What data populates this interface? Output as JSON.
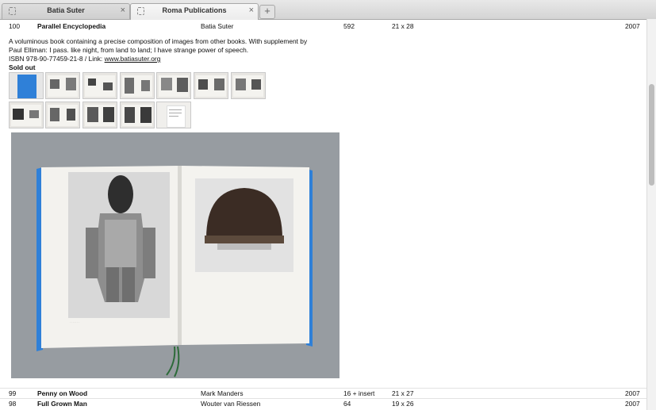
{
  "tabs": [
    {
      "label": "Batia Suter",
      "close": "×"
    },
    {
      "label": "Roma Publications",
      "close": "×"
    }
  ],
  "new_tab_label": "+",
  "entries": [
    {
      "number": "100",
      "title": "Parallel Encyclopedia",
      "author": "Batia Suter",
      "pages": "592",
      "size": "21 x 28",
      "year": "2007"
    },
    {
      "number": "99",
      "title": "Penny on Wood",
      "author": "Mark Manders",
      "pages": "16 + insert",
      "size": "21 x 27",
      "year": "2007"
    },
    {
      "number": "98",
      "title": "Full Grown Man",
      "author": "Wouter van Riessen",
      "pages": "64",
      "size": "19 x 26",
      "year": "2007"
    }
  ],
  "detail": {
    "description_line1": "A voluminous book containing a precise composition of images from other books. With supplement by",
    "description_line2": "Paul Elliman: I pass. like night, from land to land; I have strange power of speech.",
    "isbn_prefix": "ISBN 978-90-77459-21-8 / Link: ",
    "link_text": "www.batiasuter.org",
    "status": "Sold out"
  },
  "colors": {
    "book_cover": "#2f80d8",
    "tab_active": "#f2f2f2",
    "text": "#111111"
  }
}
